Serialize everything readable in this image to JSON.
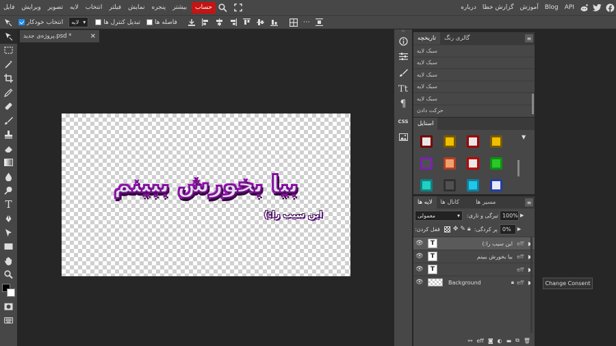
{
  "menubar": {
    "left_items": [
      {
        "label": "فایل"
      },
      {
        "label": "ویرایش"
      },
      {
        "label": "تصویر"
      },
      {
        "label": "لایه"
      },
      {
        "label": "انتخاب"
      },
      {
        "label": "فیلتر"
      },
      {
        "label": "نمایش"
      },
      {
        "label": "پنجره"
      },
      {
        "label": "بیشتر"
      }
    ],
    "account_label": "حساب",
    "right_items": [
      {
        "label": "درباره"
      },
      {
        "label": "گزارش خطا"
      },
      {
        "label": "آموزش"
      },
      {
        "label": "Blog"
      },
      {
        "label": "API"
      }
    ]
  },
  "options": {
    "auto_select_label": "انتخاب خودکار",
    "auto_select_checked": true,
    "layer_select_value": "لایه",
    "transform_controls_label": "تبدیل کنترل ها",
    "distances_label": "فاصله ها"
  },
  "document": {
    "tab_title": "پروژه‌ی جدید.psd *",
    "headline_text": "بیا بخورش ببینم",
    "subline_text": "این سیب را:)"
  },
  "history_panel": {
    "tabs": [
      {
        "label": "تاریخچه"
      },
      {
        "label": "گالری رنگ"
      }
    ],
    "rows": [
      {
        "label": "سبک لایه"
      },
      {
        "label": "سبک لایه"
      },
      {
        "label": "سبک لایه"
      },
      {
        "label": "سبک لایه"
      },
      {
        "label": "سبک لایه"
      },
      {
        "label": "حرکت دادن"
      }
    ]
  },
  "styles_panel": {
    "tab_label": "استایل",
    "swatch_colors": [
      "#e8e8e8",
      "#f0c000",
      "#e8e8e8",
      "#f0c000",
      "#505050",
      "#f0a070",
      "#e8e8e8",
      "#28c828",
      "#20d0c0",
      "#505050",
      "#20c8e8",
      "#e8e8ff"
    ]
  },
  "layers_panel": {
    "tabs": [
      {
        "label": "لایه ها"
      },
      {
        "label": "کانال ها"
      },
      {
        "label": "مسیر ها"
      }
    ],
    "blend_mode": "معمولی",
    "opacity_label": "تیرگی و تاری:",
    "opacity_value": "100%",
    "lock_label": "قفل کردن:",
    "fill_label": "پر کردگی:",
    "fill_value": "0%",
    "layers": [
      {
        "name": "این سیب را:)",
        "thumb": "T",
        "eff": "eff",
        "selected": true
      },
      {
        "name": "بیا بخورش ببینم",
        "thumb": "T",
        "eff": "eff",
        "selected": false
      },
      {
        "name": "",
        "thumb": "T",
        "eff": "eff",
        "selected": false
      },
      {
        "name": "Background",
        "thumb": "",
        "eff": "eff",
        "selected": false
      }
    ],
    "footer_eff": "eff"
  },
  "consent_button": "Change Consent",
  "colors": {
    "accent": "#c41414",
    "panel": "#474747",
    "background": "#262626"
  }
}
